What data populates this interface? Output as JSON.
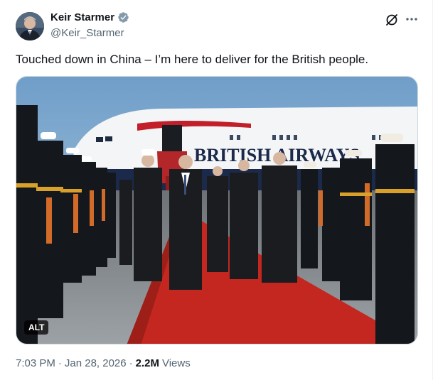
{
  "author": {
    "display_name": "Keir Starmer",
    "handle": "@Keir_Starmer",
    "verified": true
  },
  "tweet": {
    "text": "Touched down in China – I’m here to deliver for the British people.",
    "media": {
      "alt_label": "ALT",
      "fuselage_text": "BRITISH AIRWAYS"
    }
  },
  "meta": {
    "time": "7:03 PM",
    "date": "Jan 28, 2026",
    "views_count": "2.2M",
    "views_label": "Views",
    "separator": "·"
  },
  "icons": {
    "verified": "verified-badge-icon",
    "grok": "grok-icon",
    "more": "more-icon"
  },
  "colors": {
    "verified_badge": "#829aab",
    "secondary_text": "#536471",
    "primary_text": "#0f1419",
    "carpet_red": "#c3271f"
  }
}
